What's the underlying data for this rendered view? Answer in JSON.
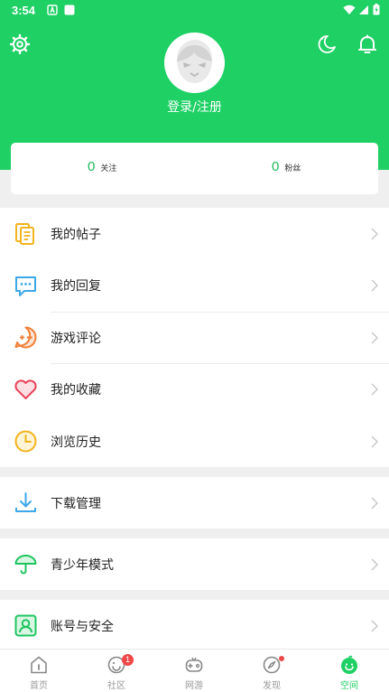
{
  "status_bar": {
    "time": "3:54"
  },
  "header": {
    "login_text": "登录/注册",
    "bg_color": "#1fd065",
    "left_icon": "settings-icon",
    "right_icons": [
      "night-mode-icon",
      "bell-icon"
    ]
  },
  "stats": [
    {
      "value": "0",
      "label": "关注"
    },
    {
      "value": "0",
      "label": "粉丝"
    }
  ],
  "menu": {
    "group1": [
      {
        "label": "我的帖子",
        "icon": "posts-icon"
      },
      {
        "label": "我的回复",
        "icon": "reply-icon"
      },
      {
        "label": "游戏评论",
        "icon": "game-comment-icon"
      },
      {
        "label": "我的收藏",
        "icon": "heart-icon"
      },
      {
        "label": "浏览历史",
        "icon": "clock-icon"
      }
    ],
    "group2": [
      {
        "label": "下载管理",
        "icon": "download-icon"
      }
    ],
    "group3": [
      {
        "label": "青少年模式",
        "icon": "umbrella-icon"
      }
    ],
    "group4": [
      {
        "label": "账号与安全",
        "icon": "account-icon"
      }
    ]
  },
  "tabbar": {
    "items": [
      {
        "label": "首页",
        "icon": "home-icon"
      },
      {
        "label": "社区",
        "icon": "community-icon",
        "badge": "1"
      },
      {
        "label": "网游",
        "icon": "gamepad-icon"
      },
      {
        "label": "发现",
        "icon": "compass-icon"
      },
      {
        "label": "空间",
        "icon": "space-icon",
        "active": true
      }
    ]
  }
}
